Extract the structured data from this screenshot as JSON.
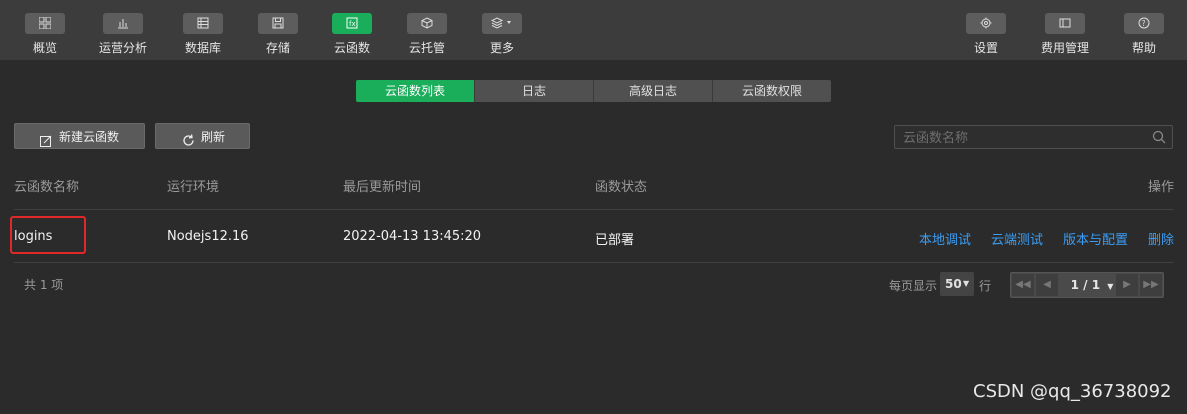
{
  "toolbar": {
    "items": [
      {
        "label": "概览",
        "icon": "grid-icon"
      },
      {
        "label": "运营分析",
        "icon": "bar-chart-icon"
      },
      {
        "label": "数据库",
        "icon": "database-icon"
      },
      {
        "label": "存储",
        "icon": "save-icon"
      },
      {
        "label": "云函数",
        "icon": "function-icon"
      },
      {
        "label": "云托管",
        "icon": "cube-icon"
      },
      {
        "label": "更多",
        "icon": "layers-icon"
      }
    ],
    "right_items": [
      {
        "label": "设置",
        "icon": "gear-icon"
      },
      {
        "label": "费用管理",
        "icon": "card-icon"
      },
      {
        "label": "帮助",
        "icon": "help-icon"
      }
    ]
  },
  "tabs": [
    "云函数列表",
    "日志",
    "高级日志",
    "云函数权限"
  ],
  "actions": {
    "new_label": "新建云函数",
    "refresh_label": "刷新"
  },
  "search": {
    "placeholder": "云函数名称"
  },
  "table": {
    "headers": [
      "云函数名称",
      "运行环境",
      "最后更新时间",
      "函数状态",
      "操作"
    ],
    "rows": [
      {
        "name": "logins",
        "runtime": "Nodejs12.16",
        "updated": "2022-04-13 13:45:20",
        "status": "已部署",
        "ops": [
          "本地调试",
          "云端测试",
          "版本与配置",
          "删除"
        ]
      }
    ]
  },
  "footer": {
    "total": "共 1 项",
    "per_page_label": "每页显示",
    "per_page_value": "50",
    "per_page_unit": "行",
    "page_indicator": "1 / 1"
  },
  "watermark": "CSDN @qq_36738092",
  "colors": {
    "accent": "#1aad5a",
    "link": "#3b9df5",
    "highlight": "#e02828"
  }
}
